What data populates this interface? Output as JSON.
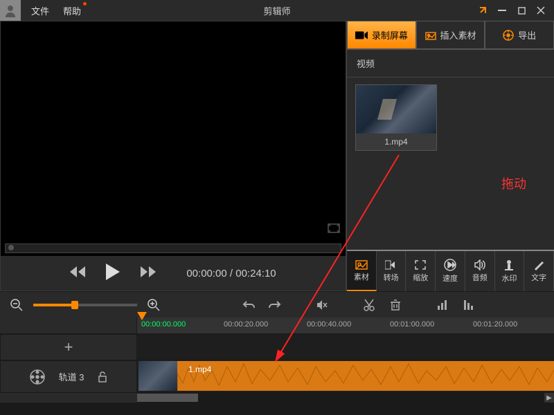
{
  "titlebar": {
    "menu_file": "文件",
    "menu_help": "帮助",
    "app_title": "剪辑师"
  },
  "preview": {
    "current_time": "00:00:00",
    "total_time": "00:24:10"
  },
  "right_panel": {
    "tabs": {
      "record": "录制屏幕",
      "insert": "插入素材",
      "export": "导出"
    },
    "section_label": "视频",
    "media": {
      "item1_name": "1.mp4"
    },
    "drag_hint": "拖动",
    "tools": {
      "material": "素材",
      "transition": "转场",
      "zoom": "缩放",
      "speed": "速度",
      "audio": "音频",
      "watermark": "水印",
      "text": "文字"
    }
  },
  "timeline": {
    "playhead_time": "00:00:00.000",
    "ticks": [
      "00:00:20.000",
      "00:00:40.000",
      "00:01:00.000",
      "00:01:20.000"
    ],
    "track_label": "轨道 3",
    "clip1_name": "1.mp4"
  }
}
